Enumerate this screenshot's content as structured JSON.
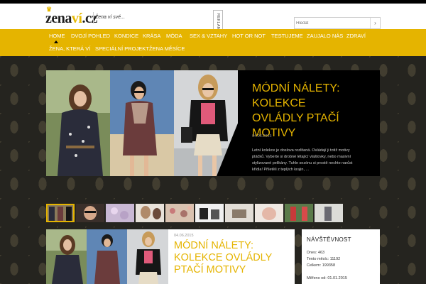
{
  "header": {
    "logo_main": "zena",
    "logo_accent": "ví",
    "logo_tld": ".cz",
    "tagline": "Žena ví své...",
    "ad_label": "REKLAMA",
    "search_placeholder": "Hledat",
    "search_button_icon": "chevron-right-icon"
  },
  "nav": {
    "row1": [
      "Home",
      "Dvojí pohled",
      "Kondice",
      "Krása",
      "Móda",
      "Sex & vztahy",
      "Hot or not",
      "Testujeme",
      "Zaujalo nás",
      "Zdraví"
    ],
    "row2": [
      "Žena, která ví",
      "Speciální projekt",
      "Žena měsíce"
    ],
    "active": "Home"
  },
  "slider": {
    "title": "MÓDNÍ NÁLETY: KOLEKCE OVLÁDLY PTAČÍ MOTIVY",
    "date": "04.06.2015",
    "text": "Letní kolekce je doslova rozlítaná. Ovládají ji totiž motivy ptáčků. Vyberte si drobné létající vlaštovky, nebo masivní stylizované pelikány. Tuhle sezónu si prostě nechte narůst křídla! Přiletěli z teplých krajin, ..."
  },
  "post": {
    "date": "04.06.2015",
    "title": "MÓDNÍ NÁLETY: KOLEKCE OVLÁDLY PTAČÍ MOTIVY"
  },
  "stats": {
    "title": "Návštěvnost",
    "today": "Dnes: 463",
    "month": "Tento měsíc: 11192",
    "total": "Celkem: 199358",
    "since": "Měřeno od: 01.01.2015"
  },
  "colors": {
    "accent": "#e5b400",
    "dark_bg": "#25241f"
  }
}
